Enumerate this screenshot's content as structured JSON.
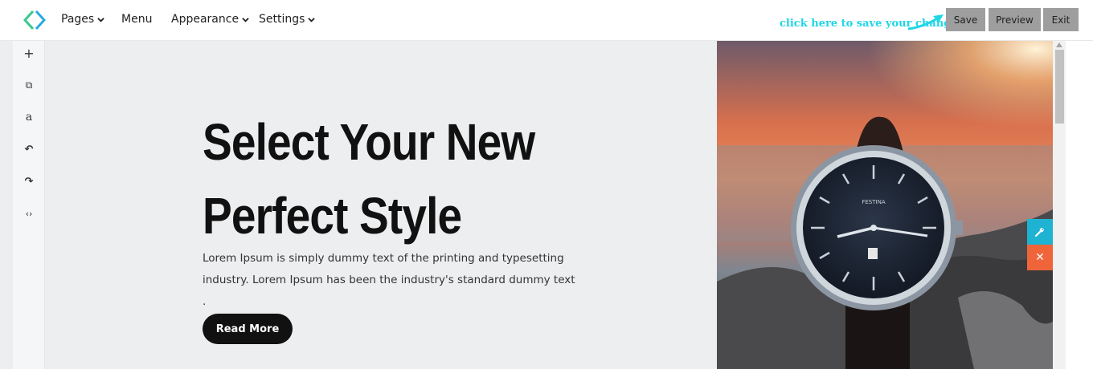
{
  "topbar": {
    "nav": [
      {
        "label": "Pages",
        "has_dropdown": true
      },
      {
        "label": "Menu",
        "has_dropdown": false
      },
      {
        "label": "Appearance",
        "has_dropdown": true
      },
      {
        "label": "Settings",
        "has_dropdown": true
      }
    ],
    "hint": "click here to save your changes",
    "buttons": {
      "save": "Save",
      "preview": "Preview",
      "exit": "Exit"
    }
  },
  "rail": {
    "items": [
      {
        "icon": "plus-icon",
        "glyph": "+"
      },
      {
        "icon": "copy-icon",
        "glyph": "⧉"
      },
      {
        "icon": "text-icon",
        "glyph": "a"
      },
      {
        "icon": "undo-icon",
        "glyph": "↶"
      },
      {
        "icon": "redo-icon",
        "glyph": "↷"
      },
      {
        "icon": "code-icon",
        "glyph": "‹›"
      }
    ]
  },
  "hero": {
    "headline_line1": "Select Your New",
    "headline_line2": "Perfect Style",
    "paragraph": "Lorem Ipsum is simply dummy text of the printing and typesetting industry. Lorem Ipsum has been the industry's standard dummy text .",
    "button": "Read More",
    "watch_brand": "FESTINA"
  },
  "floating": {
    "edit_icon": "wrench-icon",
    "close_icon": "close-icon",
    "close_glyph": "✕"
  },
  "colors": {
    "accent_cyan": "#1fb3d3",
    "accent_orange": "#f0643a",
    "logo_green": "#35c98e",
    "logo_blue": "#2aa9e0",
    "hint": "#1fd6e6",
    "toolbar_button": "#9e9e9e"
  }
}
